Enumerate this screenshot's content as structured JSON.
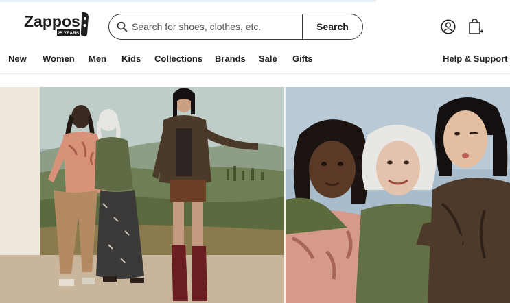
{
  "brand": {
    "name": "Zappos",
    "badge": "25 YEARS"
  },
  "search": {
    "placeholder": "Search for shoes, clothes, etc.",
    "value": "",
    "button_label": "Search"
  },
  "header": {
    "account_icon": "account-icon",
    "bag_icon": "shopping-bag-icon"
  },
  "nav": {
    "items": [
      {
        "label": "New"
      },
      {
        "label": "Women"
      },
      {
        "label": "Men"
      },
      {
        "label": "Kids"
      },
      {
        "label": "Collections"
      },
      {
        "label": "Brands"
      },
      {
        "label": "Sale"
      },
      {
        "label": "Gifts"
      }
    ],
    "help_label": "Help & Support"
  },
  "colors": {
    "text": "#1f1f1f",
    "border": "#3a3a3a",
    "accent": "#e8eef6"
  }
}
